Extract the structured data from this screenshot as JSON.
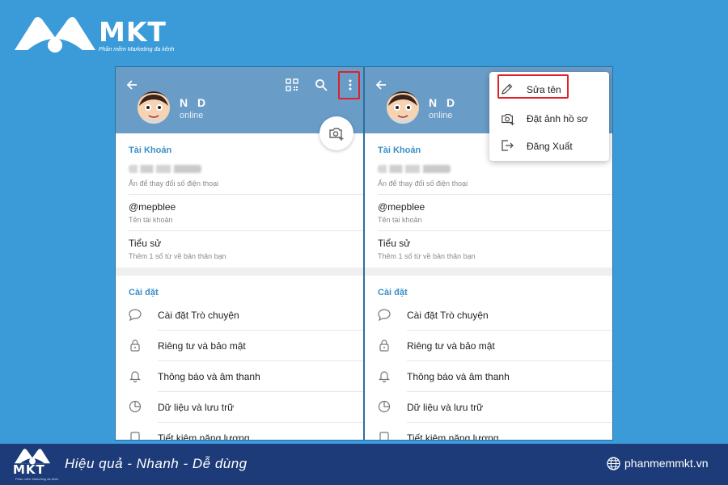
{
  "brand": {
    "name": "MKT",
    "tagline": "Phần mềm Marketing đa kênh",
    "slogan": "Hiệu quả - Nhanh  - Dễ dùng",
    "website": "phanmemmkt.vn"
  },
  "profile": {
    "name": "N D",
    "status": "online"
  },
  "account": {
    "section_title": "Tài Khoản",
    "phone_hint": "Ấn để thay đổi số điện thoại",
    "username": "@mepblee",
    "username_label": "Tên tài khoản",
    "bio_title": "Tiểu sử",
    "bio_hint": "Thêm 1 số từ về bản thân bạn"
  },
  "settings": {
    "section_title": "Cài đặt",
    "items": [
      {
        "label": "Cài đặt Trò chuyện",
        "icon": "chat-bubble-icon"
      },
      {
        "label": "Riêng tư và bảo mật",
        "icon": "lock-icon"
      },
      {
        "label": "Thông báo và âm thanh",
        "icon": "bell-icon"
      },
      {
        "label": "Dữ liệu và lưu trữ",
        "icon": "pie-chart-icon"
      },
      {
        "label": "Tiết kiệm năng lượng",
        "icon": "battery-icon"
      }
    ]
  },
  "menu": {
    "items": [
      {
        "label": "Sửa tên",
        "icon": "pencil-icon"
      },
      {
        "label": "Đặt ảnh hồ sơ",
        "icon": "camera-add-icon"
      },
      {
        "label": "Đăng Xuất",
        "icon": "logout-icon"
      }
    ]
  },
  "colors": {
    "background": "#3a9bd8",
    "header": "#6a9cc8",
    "accent": "#3a8fc9",
    "highlight": "#e0202a",
    "footer": "#1c3b78"
  }
}
